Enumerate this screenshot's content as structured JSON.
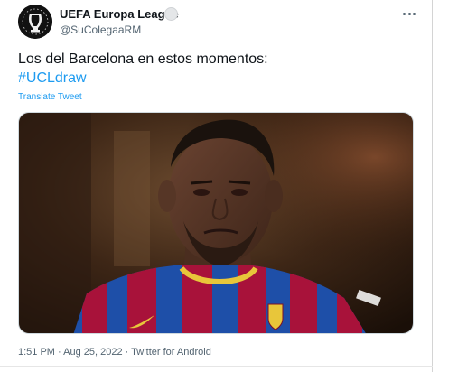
{
  "tweet": {
    "display_name": "UEFA Europa League",
    "handle": "@SuColegaaRM",
    "text": "Los del Barcelona en estos momentos:",
    "hashtag": "#UCLdraw",
    "translate_label": "Translate Tweet",
    "time": "1:51 PM",
    "date": "Aug 25, 2022",
    "source": "Twitter for Android",
    "separator": " · "
  },
  "colors": {
    "link": "#1d9bf0",
    "text": "#0f1419",
    "muted": "#536471",
    "jersey_blue": "#1e4fa8",
    "jersey_red": "#a8123a",
    "collar_yellow": "#e8c63a"
  },
  "icons": {
    "avatar": "europa-league-logo",
    "badge": "verified-badge",
    "more": "more-options-icon"
  }
}
